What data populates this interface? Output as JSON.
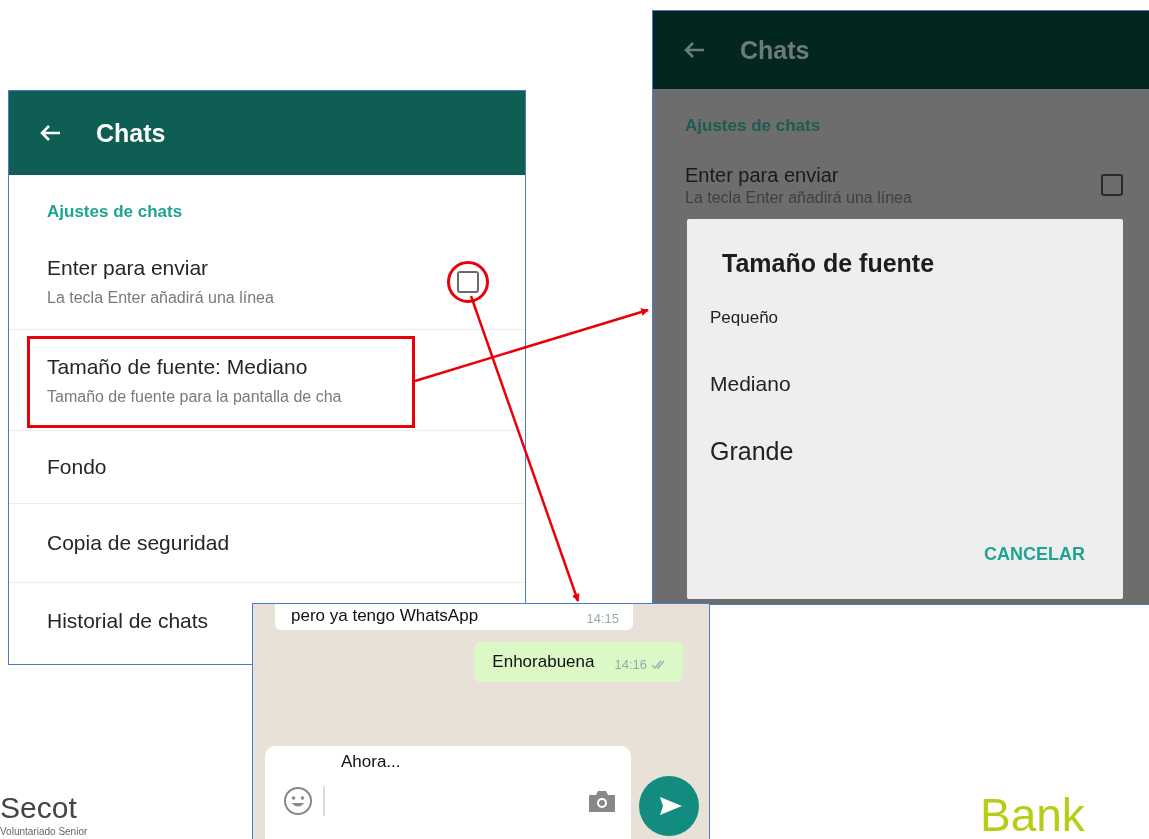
{
  "settings_screen": {
    "title": "Chats",
    "section": "Ajustes de chats",
    "items": [
      {
        "kind": "checkbox",
        "title": "Enter para enviar",
        "subtitle": "La tecla Enter añadirá una línea",
        "checked": false,
        "circled": true
      },
      {
        "kind": "plain",
        "title": "Tamaño de fuente: Mediano",
        "subtitle": "Tamaño de fuente para la pantalla de cha",
        "highlighted": true
      },
      {
        "kind": "plain",
        "title": "Fondo"
      },
      {
        "kind": "plain",
        "title": "Copia de seguridad"
      },
      {
        "kind": "plain",
        "title": "Historial de chats"
      }
    ]
  },
  "dialog_screen": {
    "title": "Chats",
    "section": "Ajustes de chats",
    "item": {
      "title": "Enter para enviar",
      "subtitle": "La tecla Enter añadirá una línea",
      "checked": false
    },
    "dialog": {
      "title": "Tamaño de fuente",
      "options": [
        {
          "kind": "small",
          "label": "Pequeño"
        },
        {
          "kind": "medium",
          "label": "Mediano"
        },
        {
          "kind": "large",
          "label": "Grande"
        }
      ],
      "button": "CANCELAR"
    }
  },
  "chat_screen": {
    "messages": [
      {
        "kind": "incoming",
        "text": "pero ya tengo WhatsApp",
        "time": "14:15"
      },
      {
        "kind": "outgoing",
        "text": "Enhorabuena",
        "time": "14:16",
        "read": true
      }
    ],
    "input": {
      "value": "Ahora..."
    }
  },
  "logos": [
    {
      "kind": "secot",
      "name": "Secot",
      "tagline": "Voluntariado Senior"
    },
    {
      "kind": "bank",
      "name": "Bank"
    }
  ]
}
